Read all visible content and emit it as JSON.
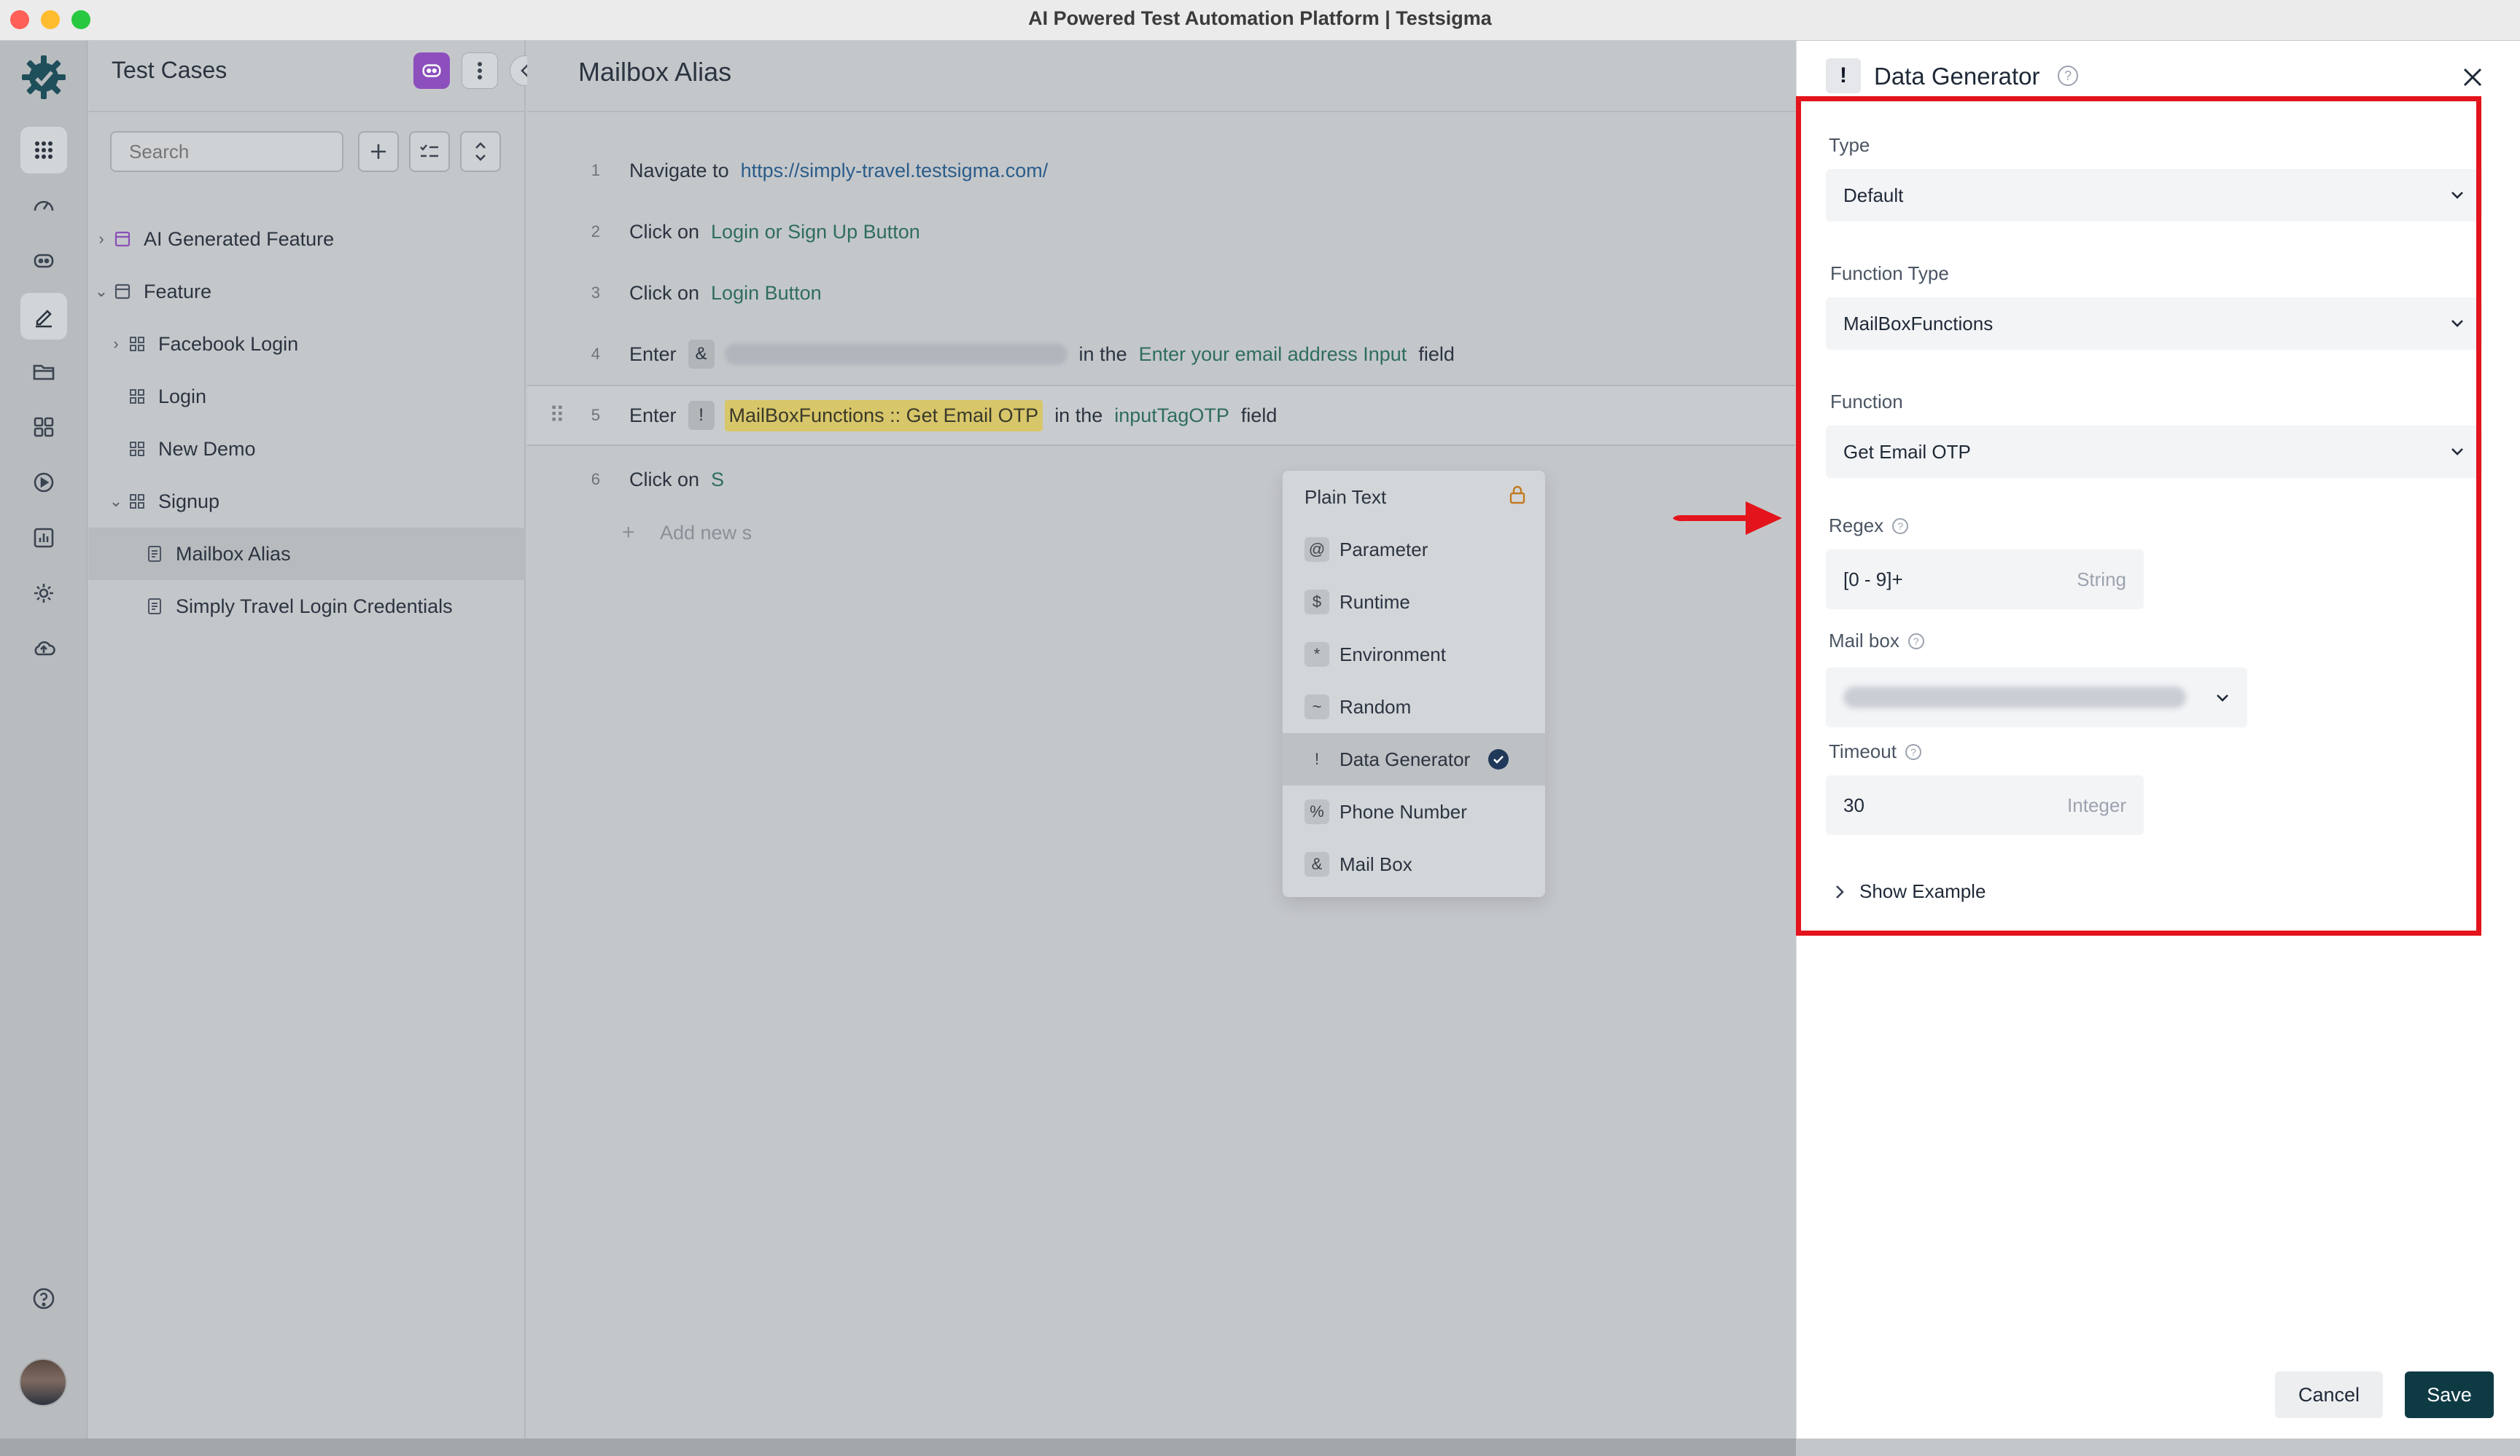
{
  "window": {
    "title": "AI Powered Test Automation Platform | Testsigma"
  },
  "rail": {
    "items": [
      "apps-icon",
      "dashboard-icon",
      "ai-agent-icon",
      "test-cases-icon",
      "folder-icon",
      "elements-icon",
      "runs-icon",
      "reports-icon",
      "settings-icon",
      "cloud-upload-icon"
    ],
    "bottom": [
      "help-icon",
      "avatar"
    ]
  },
  "test_cases": {
    "title": "Test Cases",
    "search_placeholder": "Search",
    "tree": [
      {
        "label": "AI Generated Feature",
        "level": 0,
        "expanded": false,
        "type": "feature"
      },
      {
        "label": "Feature",
        "level": 0,
        "expanded": true,
        "type": "feature"
      },
      {
        "label": "Facebook Login",
        "level": 1,
        "expanded": false,
        "type": "group"
      },
      {
        "label": "Login",
        "level": 1,
        "type": "group"
      },
      {
        "label": "New Demo",
        "level": 1,
        "type": "group"
      },
      {
        "label": "Signup",
        "level": 1,
        "expanded": true,
        "type": "group"
      },
      {
        "label": "Mailbox Alias",
        "level": 2,
        "type": "case",
        "selected": true
      },
      {
        "label": "Simply Travel Login Credentials",
        "level": 2,
        "type": "case"
      }
    ]
  },
  "editor": {
    "title": "Mailbox Alias",
    "steps": [
      {
        "num": "1",
        "kw": "Navigate to",
        "link": "https://simply-travel.testsigma.com/"
      },
      {
        "num": "2",
        "kw": "Click on",
        "elem": "Login or Sign Up Button"
      },
      {
        "num": "3",
        "kw": "Click on",
        "elem": "Login Button"
      },
      {
        "num": "4",
        "kw": "Enter",
        "tag": "&",
        "in_the": "in the",
        "elem": "Enter your email address Input",
        "field": "field"
      },
      {
        "num": "5",
        "kw": "Enter",
        "tag": "!",
        "value": "MailBoxFunctions :: Get Email OTP",
        "in_the": "in the",
        "elem": "inputTagOTP",
        "field": "field"
      },
      {
        "num": "6",
        "kw": "Click on",
        "elem": "S"
      }
    ],
    "add_new": "Add new s"
  },
  "dropdown": {
    "items": [
      {
        "symbol": "",
        "label": "Plain Text",
        "locked": true
      },
      {
        "symbol": "@",
        "label": "Parameter"
      },
      {
        "symbol": "$",
        "label": "Runtime"
      },
      {
        "symbol": "*",
        "label": "Environment"
      },
      {
        "symbol": "~",
        "label": "Random"
      },
      {
        "symbol": "!",
        "label": "Data Generator",
        "selected": true
      },
      {
        "symbol": "%",
        "label": "Phone Number"
      },
      {
        "symbol": "&",
        "label": "Mail Box"
      }
    ]
  },
  "panel": {
    "icon": "!",
    "title": "Data Generator",
    "type_label": "Type",
    "type_value": "Default",
    "function_type_label": "Function Type",
    "function_type_value": "MailBoxFunctions",
    "function_label": "Function",
    "function_value": "Get Email OTP",
    "regex_label": "Regex",
    "regex_value": "[0 - 9]+",
    "regex_type": "String",
    "mailbox_label": "Mail box",
    "timeout_label": "Timeout",
    "timeout_value": "30",
    "timeout_type": "Integer",
    "show_example": "Show Example",
    "cancel": "Cancel",
    "save": "Save"
  },
  "colors": {
    "highlight_box": "#e3141b",
    "save_button": "#0e3a44",
    "brand": "#1a4d5c"
  }
}
